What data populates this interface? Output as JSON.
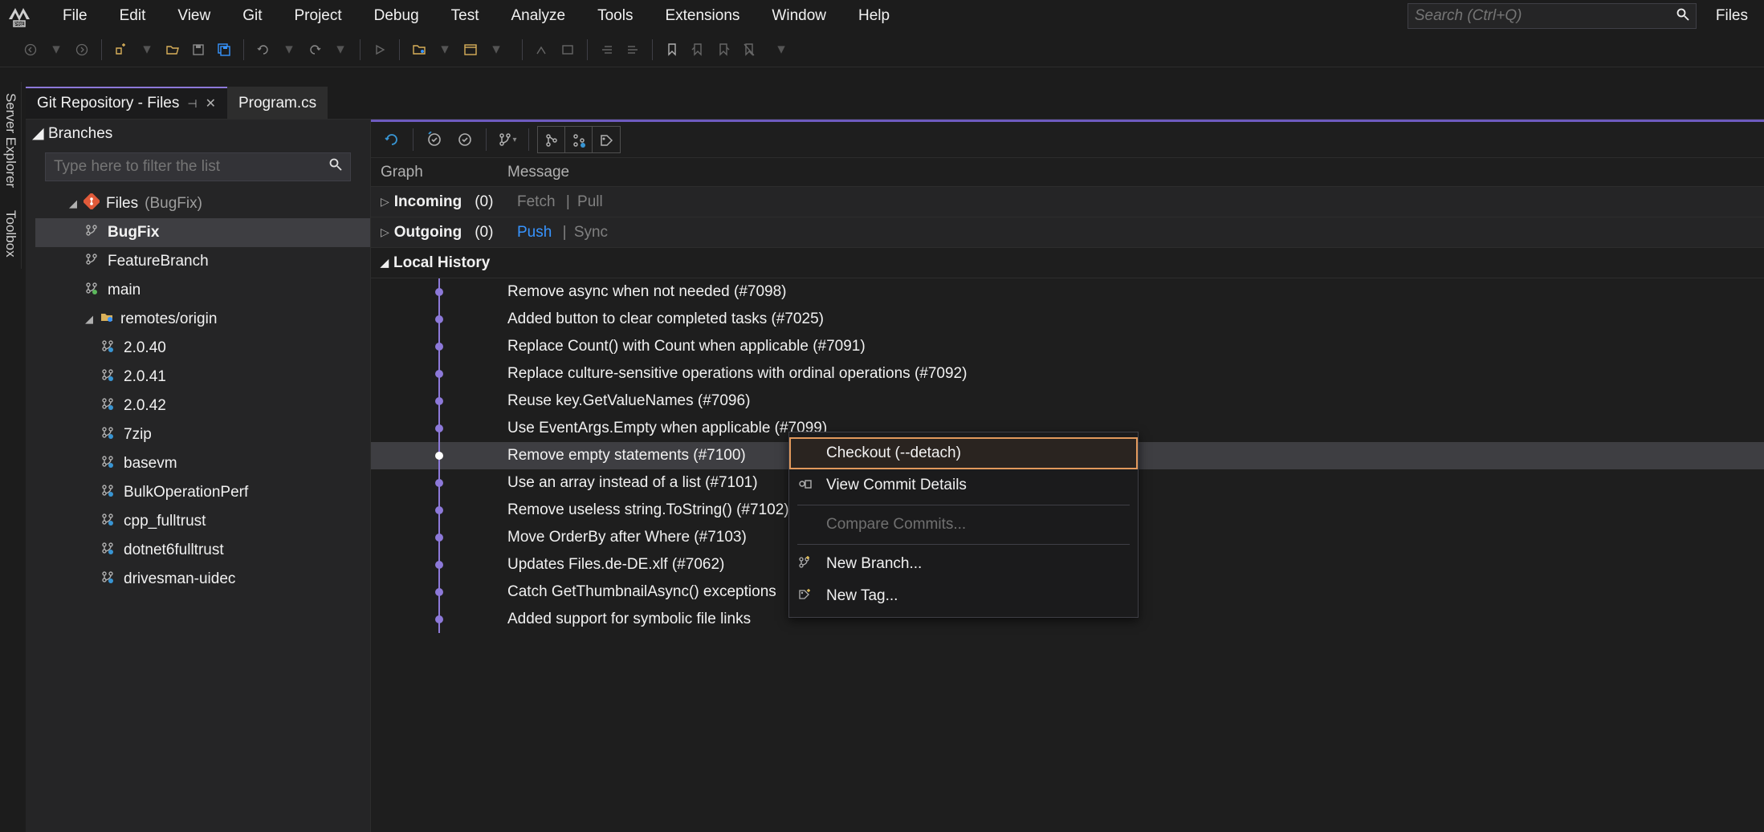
{
  "menubar": {
    "items": [
      "File",
      "Edit",
      "View",
      "Git",
      "Project",
      "Debug",
      "Test",
      "Analyze",
      "Tools",
      "Extensions",
      "Window",
      "Help"
    ],
    "search_placeholder": "Search (Ctrl+Q)",
    "right_label": "Files"
  },
  "doc_tabs": [
    {
      "label": "Git Repository - Files",
      "active": true,
      "pinned": true
    },
    {
      "label": "Program.cs",
      "active": false
    }
  ],
  "side_tabs": [
    "Server Explorer",
    "Toolbox"
  ],
  "branches_panel": {
    "title": "Branches",
    "filter_placeholder": "Type here to filter the list",
    "repo_name": "Files",
    "repo_sub": "(BugFix)",
    "local_branches": [
      "BugFix",
      "FeatureBranch",
      "main"
    ],
    "remotes_label": "remotes/origin",
    "remote_branches": [
      "2.0.40",
      "2.0.41",
      "2.0.42",
      "7zip",
      "basevm",
      "BulkOperationPerf",
      "cpp_fulltrust",
      "dotnet6fulltrust",
      "drivesman-uidec"
    ]
  },
  "history": {
    "col_graph": "Graph",
    "col_message": "Message",
    "incoming_label": "Incoming",
    "incoming_count": "(0)",
    "incoming_links": [
      "Fetch",
      "Pull"
    ],
    "outgoing_label": "Outgoing",
    "outgoing_count": "(0)",
    "outgoing_links": [
      "Push",
      "Sync"
    ],
    "local_history_label": "Local History",
    "commits": [
      {
        "msg": "Remove async when not needed (#7098)",
        "current": false
      },
      {
        "msg": "Added button to clear completed tasks (#7025)",
        "current": false
      },
      {
        "msg": "Replace Count() with Count when applicable (#7091)",
        "current": false
      },
      {
        "msg": "Replace culture-sensitive operations with ordinal operations (#7092)",
        "current": false
      },
      {
        "msg": "Reuse key.GetValueNames (#7096)",
        "current": false
      },
      {
        "msg": "Use EventArgs.Empty when applicable (#7099)",
        "current": false
      },
      {
        "msg": "Remove empty statements (#7100)",
        "current": true
      },
      {
        "msg": "Use an array instead of a list (#7101)",
        "current": false
      },
      {
        "msg": "Remove useless string.ToString() (#7102)",
        "current": false
      },
      {
        "msg": "Move OrderBy after Where (#7103)",
        "current": false
      },
      {
        "msg": "Updates Files.de-DE.xlf (#7062)",
        "current": false
      },
      {
        "msg": "Catch GetThumbnailAsync() exceptions",
        "current": false
      },
      {
        "msg": "Added support for symbolic file links",
        "current": false
      }
    ]
  },
  "context_menu": {
    "items": [
      {
        "label": "Checkout (--detach)",
        "icon": "",
        "hover": true
      },
      {
        "label": "View Commit Details",
        "icon": "commit-details-icon"
      },
      {
        "label": "Compare Commits...",
        "icon": "",
        "disabled": true,
        "sep_before": true
      },
      {
        "label": "New Branch...",
        "icon": "new-branch-icon",
        "sep_before": true
      },
      {
        "label": "New Tag...",
        "icon": "new-tag-icon"
      }
    ]
  }
}
